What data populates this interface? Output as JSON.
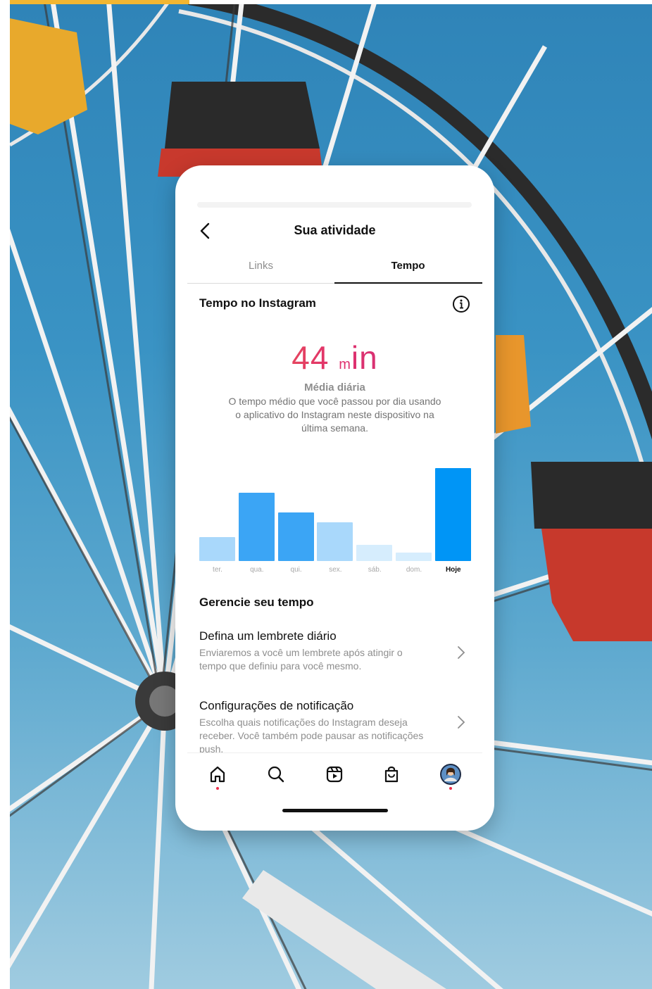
{
  "page": {
    "title": "Sua atividade",
    "tabs": [
      {
        "label": "Links",
        "active": false
      },
      {
        "label": "Tempo",
        "active": true
      }
    ]
  },
  "time_section": {
    "heading": "Tempo no Instagram",
    "value_number": "44",
    "value_unit": "m",
    "value_suffix": "in",
    "average_label": "Média diária",
    "description": "O tempo médio que você passou por dia usando o aplicativo do Instagram neste dispositivo na última semana."
  },
  "chart_data": {
    "type": "bar",
    "categories": [
      "ter.",
      "qua.",
      "qui.",
      "sex.",
      "sáb.",
      "dom.",
      "Hoje"
    ],
    "values": [
      25,
      72,
      51,
      41,
      17,
      9,
      98
    ],
    "ylim": [
      0,
      100
    ],
    "highlight": "Hoje",
    "colors": [
      "#a9d8fb",
      "#3ba5f5",
      "#3ba5f5",
      "#a9d8fb",
      "#d6edfd",
      "#d6edfd",
      "#0095f6"
    ]
  },
  "manage": {
    "heading": "Gerencie seu tempo",
    "items": [
      {
        "title": "Defina um lembrete diário",
        "description": "Enviaremos a você um lembrete após atingir o tempo que definiu para você mesmo."
      },
      {
        "title": "Configurações de notificação",
        "description": "Escolha quais notificações do Instagram deseja receber. Você também pode pausar as notificações push."
      }
    ]
  },
  "nav": {
    "items": [
      "home-icon",
      "search-icon",
      "reels-icon",
      "shop-icon",
      "profile-avatar"
    ]
  },
  "colors": {
    "accent_blue": "#0095f6",
    "gradient_start": "#f0803c",
    "gradient_end": "#c13584",
    "notification_dot": "#ed2d4a"
  }
}
